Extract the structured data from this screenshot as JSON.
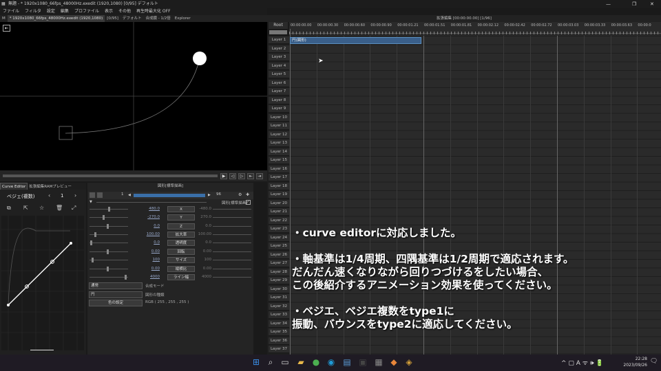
{
  "window": {
    "title": "無題 - * 1920x1080_66fps_48000Hz.exedit (1920,1080)  [0/95]  デフォルト",
    "controls": [
      "—",
      "❐",
      "✕"
    ]
  },
  "menu": [
    "ファイル",
    "フィルタ",
    "設定",
    "編集",
    "プロファイル",
    "表示",
    "その他",
    "再生時最大化 OFF"
  ],
  "tabs": {
    "m_label": "M",
    "items": [
      "* 1920x1080_66fps_48000Hz.exedit (1920,1080)",
      "[0/95]",
      "デフォルト",
      "合成鏡 - 1/2倍",
      "Explorer"
    ]
  },
  "lower_tabs": [
    "Curve Editor",
    "拡張編集RAMプレビュー"
  ],
  "curve_editor": {
    "mode": "ベジェ(複数)",
    "prev": "‹",
    "index": "1",
    "next": "›",
    "icons": [
      "copy-icon",
      "export-icon",
      "star-icon",
      "trash-icon",
      "expand-icon"
    ]
  },
  "object_settings": {
    "title": "図形[標準描画]",
    "frame_start": "1",
    "frame_end": "96",
    "right_label": "図形[標準描画]",
    "params": [
      {
        "v1": "480.0",
        "label": "X",
        "v2": "-480.0"
      },
      {
        "v1": "-270.0",
        "label": "Y",
        "v2": "270.0"
      },
      {
        "v1": "0.0",
        "label": "Z",
        "v2": "0.0"
      },
      {
        "v1": "100.00",
        "label": "拡大率",
        "v2": "100.00"
      },
      {
        "v1": "0.0",
        "label": "透明度",
        "v2": "0.0"
      },
      {
        "v1": "0.00",
        "label": "回転",
        "v2": "0.00"
      },
      {
        "v1": "100",
        "label": "サイズ",
        "v2": "100"
      },
      {
        "v1": "0.00",
        "label": "縦横比",
        "v2": "0.00"
      },
      {
        "v1": "4000",
        "label": "ライン幅",
        "v2": "4000"
      }
    ],
    "blend_select": "通常",
    "blend_label": "合成モード",
    "shape_select": "円",
    "shape_label": "図形の種類",
    "color_button": "色の設定",
    "color_value": "RGB ( 255 , 255 , 255 )"
  },
  "timeline": {
    "header": "拡張編集 [00:00:00.00] [1/96]",
    "root": "Root",
    "ruler": [
      "00:00:00.00",
      "00:00:00.30",
      "00:00:00.60",
      "00:00:00.90",
      "00:00:01.21",
      "00:00:01.51",
      "00:00:01.81",
      "00:00:02.12",
      "00:00:02.42",
      "00:00:02.72",
      "00:00:03.03",
      "00:00:03.33",
      "00:00:03.63",
      "00:00:0"
    ],
    "layers": [
      "Layer 1",
      "Layer 2",
      "Layer 3",
      "Layer 4",
      "Layer 5",
      "Layer 6",
      "Layer 7",
      "Layer 8",
      "Layer 9",
      "Layer 10",
      "Layer 11",
      "Layer 12",
      "Layer 13",
      "Layer 14",
      "Layer 15",
      "Layer 16",
      "Layer 17",
      "Layer 18",
      "Layer 19",
      "Layer 20",
      "Layer 21",
      "Layer 22",
      "Layer 23",
      "Layer 24",
      "Layer 25",
      "Layer 26",
      "Layer 27",
      "Layer 28",
      "Layer 29",
      "Layer 30",
      "Layer 31",
      "Layer 32",
      "Layer 33",
      "Layer 34",
      "Layer 35",
      "Layer 36",
      "Layer 37"
    ],
    "clip_label": "円(図形)"
  },
  "overlay": {
    "line1": "・curve editorに対応しました。",
    "line2": "・軸基準は1/4周期、四隅基準は1/2周期で適応されます。",
    "line3": "だんだん速くなりながら回りつづけるをしたい場合、",
    "line4": "この後紹介するアニメーション効果を使ってください。",
    "line5": "・ベジエ、ベジエ複数をtype1に",
    "line6": "振動、バウンスをtype2に適応してください。"
  },
  "taskbar": {
    "time": "22:28",
    "date": "2023/09/26",
    "tray": "^  ▢  A  ᯤ  🕪  🔋",
    "icons": [
      "windows-start-icon",
      "search-icon",
      "task-view-icon",
      "file-explorer-icon",
      "chrome-icon",
      "edge-icon",
      "notepad-icon",
      "terminal-icon",
      "aviutl-icon",
      "blender-icon",
      "security-icon"
    ],
    "colors": [
      "#3a8ee6",
      "#dddddd",
      "#cccccc",
      "#e8b84a",
      "#4caf50",
      "#1f9ad6",
      "#5b9bd5",
      "#444444",
      "#888888",
      "#e8863a",
      "#d4a03a"
    ]
  },
  "colors": {
    "clip": "#3a5f8a",
    "accent": "#3a8ee6"
  }
}
